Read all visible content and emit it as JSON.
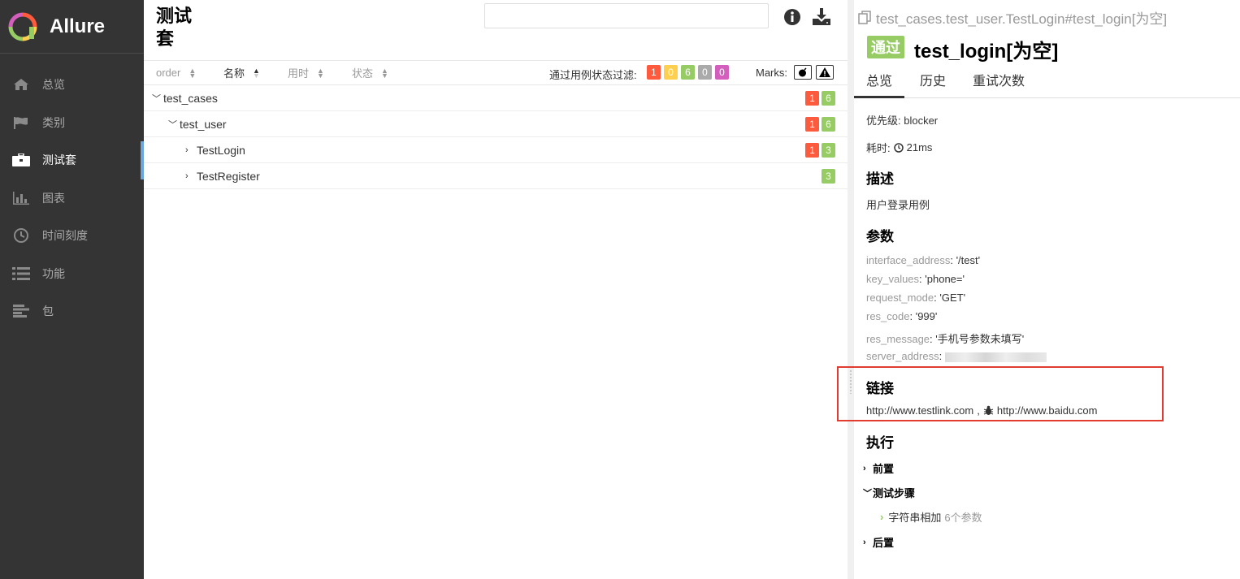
{
  "app": {
    "name": "Allure"
  },
  "sidebar": {
    "items": [
      {
        "label": "总览",
        "icon": "home-icon"
      },
      {
        "label": "类别",
        "icon": "flag-icon"
      },
      {
        "label": "测试套",
        "icon": "briefcase-icon",
        "active": true
      },
      {
        "label": "图表",
        "icon": "bar-chart-icon"
      },
      {
        "label": "时间刻度",
        "icon": "clock-icon"
      },
      {
        "label": "功能",
        "icon": "list-icon"
      },
      {
        "label": "包",
        "icon": "align-left-icon"
      }
    ]
  },
  "suites": {
    "title_line1": "测试",
    "title_line2": "套",
    "search": {
      "placeholder": ""
    },
    "columns": {
      "order": "order",
      "name": "名称",
      "duration": "用时",
      "status": "状态"
    },
    "filter_label": "通过用例状态过滤:",
    "filter_counts": [
      {
        "value": "1",
        "color": "#fd5a3e"
      },
      {
        "value": "0",
        "color": "#ffd050"
      },
      {
        "value": "6",
        "color": "#97cc64"
      },
      {
        "value": "0",
        "color": "#aaaaaa"
      },
      {
        "value": "0",
        "color": "#d35ebe"
      }
    ],
    "marks_label": "Marks:",
    "tree": [
      {
        "name": "test_cases",
        "expanded": true,
        "failed": "1",
        "passed": "6"
      },
      {
        "name": "test_user",
        "expanded": true,
        "failed": "1",
        "passed": "6"
      },
      {
        "name": "TestLogin",
        "expanded": false,
        "failed": "1",
        "passed": "3"
      },
      {
        "name": "TestRegister",
        "expanded": false,
        "failed": "",
        "passed": "3"
      }
    ]
  },
  "detail": {
    "path": "test_cases.test_user.TestLogin#test_login[为空]",
    "status": "通过",
    "title": "test_login[为空]",
    "tabs": [
      "总览",
      "历史",
      "重试次数"
    ],
    "priority": "优先级: blocker",
    "duration_label": "耗时:",
    "duration_value": "21ms",
    "description_heading": "描述",
    "description": "用户登录用例",
    "params_heading": "参数",
    "params": [
      {
        "key": "interface_address",
        "value": "'/test'"
      },
      {
        "key": "key_values",
        "value": "'phone='"
      },
      {
        "key": "request_mode",
        "value": "'GET'"
      },
      {
        "key": "res_code",
        "value": "'999'"
      },
      {
        "key": "res_message",
        "value": "'手机号参数未填写'"
      },
      {
        "key": "server_address",
        "value": ""
      }
    ],
    "links_heading": "链接",
    "link1": "http://www.testlink.com",
    "link_sep": ",",
    "link2": "http://www.baidu.com",
    "execution_heading": "执行",
    "setup": "前置",
    "test_body": "测试步骤",
    "step_name": "字符串相加",
    "step_params": "6个参数",
    "teardown": "后置"
  },
  "colors": {
    "sidebar_bg": "#343434",
    "passed": "#97cc64",
    "failed": "#fd5a3e",
    "highlight": "#e03c31",
    "active_bar": "#6aa7dd"
  }
}
